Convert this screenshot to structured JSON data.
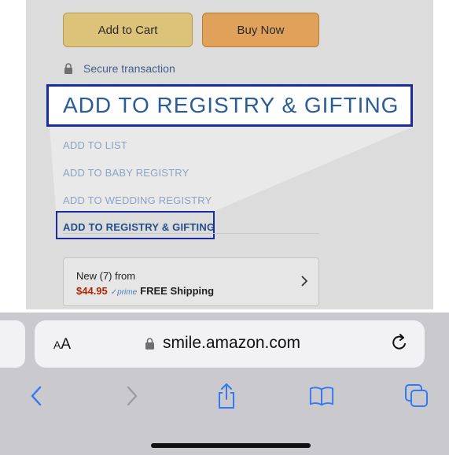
{
  "product": {
    "add_to_cart": "Add to Cart",
    "buy_now": "Buy Now",
    "secure": "Secure transaction"
  },
  "callout": {
    "label": "ADD TO REGISTRY & GIFTING"
  },
  "menu": {
    "items": [
      "ADD TO LIST",
      "ADD TO BABY REGISTRY",
      "ADD TO WEDDING REGISTRY",
      "ADD TO REGISTRY & GIFTING"
    ]
  },
  "offer": {
    "title": "New (7) from",
    "price": "$44.95",
    "prime": "✓prime",
    "shipping": "FREE Shipping"
  },
  "browser": {
    "text_size_label_small": "A",
    "text_size_label_large": "A",
    "url": "smile.amazon.com"
  },
  "colors": {
    "highlight_border": "#1b2ba0",
    "link_blue": "#2a5d97",
    "price_red": "#b12704",
    "ios_blue": "#3478f6"
  },
  "icons": [
    "lock-icon",
    "chevron-right-icon",
    "reload-icon",
    "back-icon",
    "forward-icon",
    "share-icon",
    "bookmarks-icon",
    "tabs-icon"
  ]
}
